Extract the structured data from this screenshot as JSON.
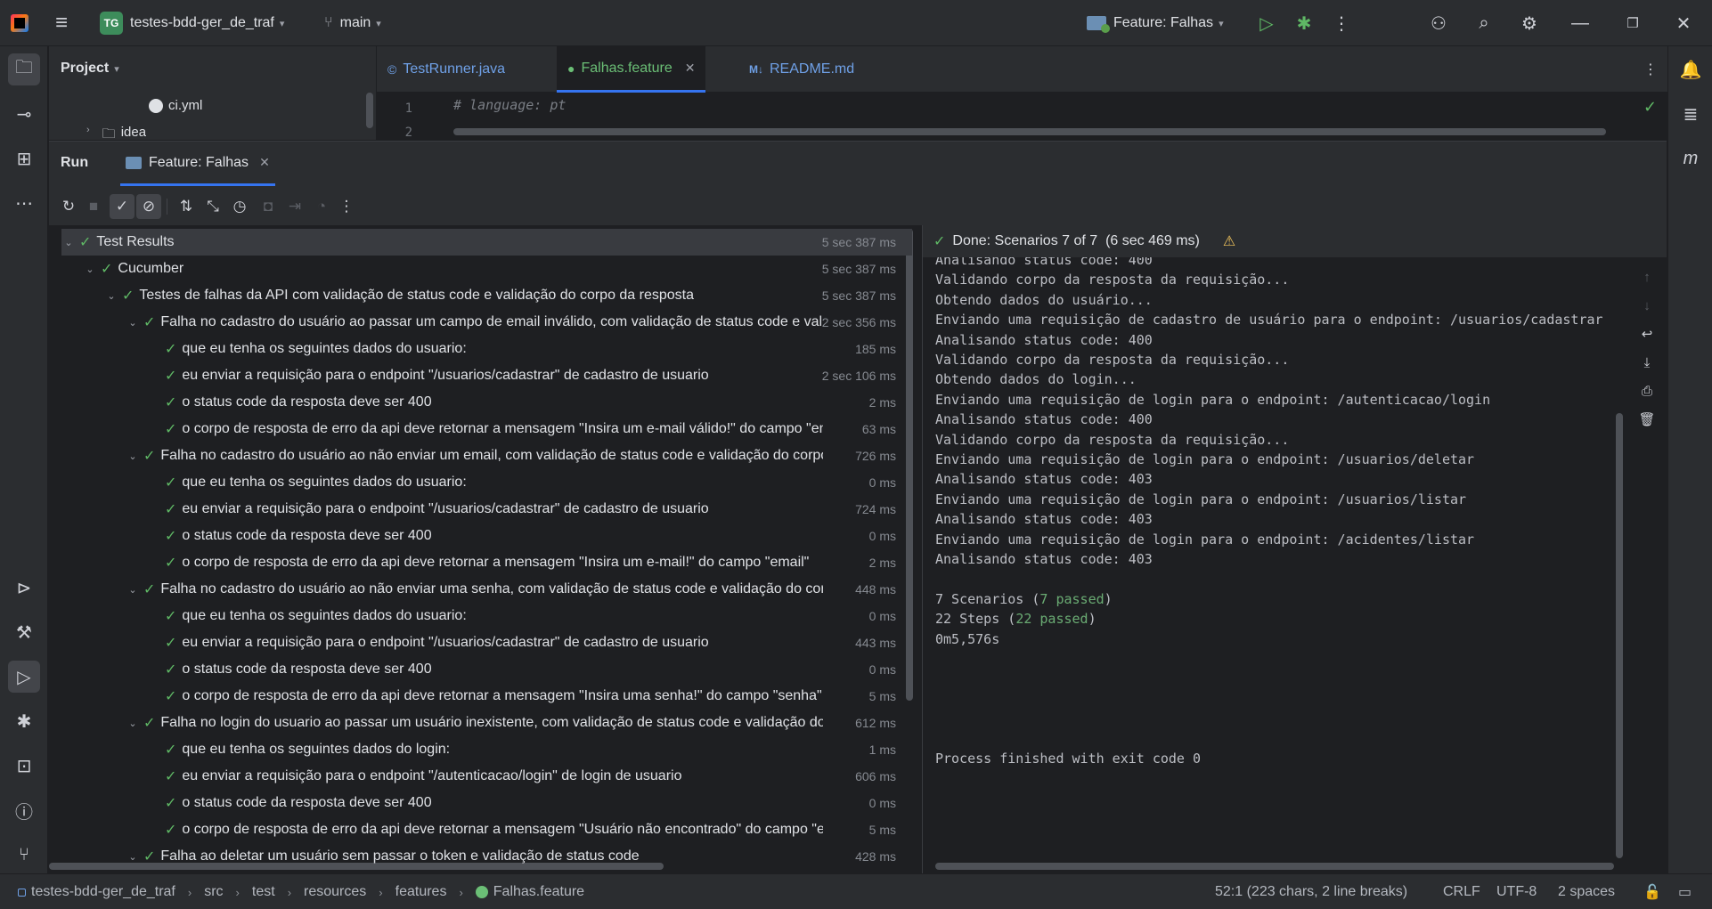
{
  "titlebar": {
    "project_initials": "TG",
    "project_name": "testes-bdd-ger_de_traf",
    "branch": "main",
    "run_config": "Feature: Falhas"
  },
  "project_panel": {
    "title": "Project",
    "items": [
      "ci.yml",
      "idea"
    ]
  },
  "editor": {
    "tabs": [
      {
        "label": "TestRunner.java",
        "active": false
      },
      {
        "label": "Falhas.feature",
        "active": true
      },
      {
        "label": "README.md",
        "active": false
      }
    ],
    "line_numbers": [
      "1",
      "2"
    ],
    "code_line_1": "# language: pt"
  },
  "run": {
    "title": "Run",
    "tab_label": "Feature: Falhas",
    "tree": [
      {
        "level": 0,
        "arrow": true,
        "text": "Test Results",
        "time": "5 sec 387 ms",
        "selected": true
      },
      {
        "level": 1,
        "arrow": true,
        "text": "Cucumber",
        "time": "5 sec 387 ms"
      },
      {
        "level": 2,
        "arrow": true,
        "text": "Testes de falhas da API com validação de status code e validação do corpo da resposta",
        "time": "5 sec 387 ms"
      },
      {
        "level": 3,
        "arrow": true,
        "text": "Falha no cadastro do usuário ao passar um campo de email inválido, com validação de status code e validação do corpo",
        "time": "2 sec 356 ms"
      },
      {
        "level": 4,
        "arrow": false,
        "text": "que eu tenha os seguintes dados do usuario:",
        "time": "185 ms"
      },
      {
        "level": 4,
        "arrow": false,
        "text": "eu enviar a requisição para o endpoint \"/usuarios/cadastrar\" de cadastro de usuario",
        "time": "2 sec 106 ms"
      },
      {
        "level": 4,
        "arrow": false,
        "text": "o status code da resposta deve ser 400",
        "time": "2 ms"
      },
      {
        "level": 4,
        "arrow": false,
        "text": "o corpo de resposta de erro da api deve retornar a mensagem \"Insira um e-mail válido!\" do campo \"email\"",
        "time": "63 ms"
      },
      {
        "level": 3,
        "arrow": true,
        "text": "Falha no cadastro do usuário ao não enviar um email, com validação de status code e validação do corpo",
        "time": "726 ms"
      },
      {
        "level": 4,
        "arrow": false,
        "text": "que eu tenha os seguintes dados do usuario:",
        "time": "0 ms"
      },
      {
        "level": 4,
        "arrow": false,
        "text": "eu enviar a requisição para o endpoint \"/usuarios/cadastrar\" de cadastro de usuario",
        "time": "724 ms"
      },
      {
        "level": 4,
        "arrow": false,
        "text": "o status code da resposta deve ser 400",
        "time": "0 ms"
      },
      {
        "level": 4,
        "arrow": false,
        "text": "o corpo de resposta de erro da api deve retornar a mensagem \"Insira um e-mail!\" do campo \"email\"",
        "time": "2 ms"
      },
      {
        "level": 3,
        "arrow": true,
        "text": "Falha no cadastro do usuário ao não enviar uma senha, com validação de status code e validação do corpo",
        "time": "448 ms"
      },
      {
        "level": 4,
        "arrow": false,
        "text": "que eu tenha os seguintes dados do usuario:",
        "time": "0 ms"
      },
      {
        "level": 4,
        "arrow": false,
        "text": "eu enviar a requisição para o endpoint \"/usuarios/cadastrar\" de cadastro de usuario",
        "time": "443 ms"
      },
      {
        "level": 4,
        "arrow": false,
        "text": "o status code da resposta deve ser 400",
        "time": "0 ms"
      },
      {
        "level": 4,
        "arrow": false,
        "text": "o corpo de resposta de erro da api deve retornar a mensagem \"Insira uma senha!\" do campo \"senha\"",
        "time": "5 ms"
      },
      {
        "level": 3,
        "arrow": true,
        "text": "Falha no login do usuario ao passar um usuário inexistente, com validação de status code e validação do corpo",
        "time": "612 ms"
      },
      {
        "level": 4,
        "arrow": false,
        "text": "que eu tenha os seguintes dados do login:",
        "time": "1 ms"
      },
      {
        "level": 4,
        "arrow": false,
        "text": "eu enviar a requisição para o endpoint \"/autenticacao/login\" de login de usuario",
        "time": "606 ms"
      },
      {
        "level": 4,
        "arrow": false,
        "text": "o status code da resposta deve ser 400",
        "time": "0 ms"
      },
      {
        "level": 4,
        "arrow": false,
        "text": "o corpo de resposta de erro da api deve retornar a mensagem \"Usuário não encontrado\" do campo \"email\"",
        "time": "5 ms"
      },
      {
        "level": 3,
        "arrow": true,
        "text": "Falha ao deletar um usuário sem passar o token e validação de status code",
        "time": "428 ms"
      }
    ],
    "console": {
      "status": "Done: Scenarios 7 of 7  (6 sec 469 ms)",
      "lines": [
        "Analisando status code: 400",
        "Validando corpo da resposta da requisição...",
        "Obtendo dados do usuário...",
        "Enviando uma requisição de cadastro de usuário para o endpoint: /usuarios/cadastrar",
        "Analisando status code: 400",
        "Validando corpo da resposta da requisição...",
        "Obtendo dados do login...",
        "Enviando uma requisição de login para o endpoint: /autenticacao/login",
        "Analisando status code: 400",
        "Validando corpo da resposta da requisição...",
        "Enviando uma requisição de login para o endpoint: /usuarios/deletar",
        "Analisando status code: 403",
        "Enviando uma requisição de login para o endpoint: /usuarios/listar",
        "Analisando status code: 403",
        "Enviando uma requisição de login para o endpoint: /acidentes/listar",
        "Analisando status code: 403"
      ],
      "summary_scenarios_prefix": "7 Scenarios (",
      "summary_scenarios_passed": "7 passed",
      "summary_steps_prefix": "22 Steps (",
      "summary_steps_passed": "22 passed",
      "close_paren": ")",
      "duration": "0m5,576s",
      "exit": "Process finished with exit code 0"
    }
  },
  "statusbar": {
    "breadcrumbs": [
      "testes-bdd-ger_de_traf",
      "src",
      "test",
      "resources",
      "features",
      "Falhas.feature"
    ],
    "position": "52:1 (223 chars, 2 line breaks)",
    "line_sep": "CRLF",
    "encoding": "UTF-8",
    "indent": "2 spaces"
  },
  "colors": {
    "accent": "#3574f0",
    "passed": "#5fb865",
    "background": "#1e1f22",
    "panel": "#2b2d30"
  }
}
